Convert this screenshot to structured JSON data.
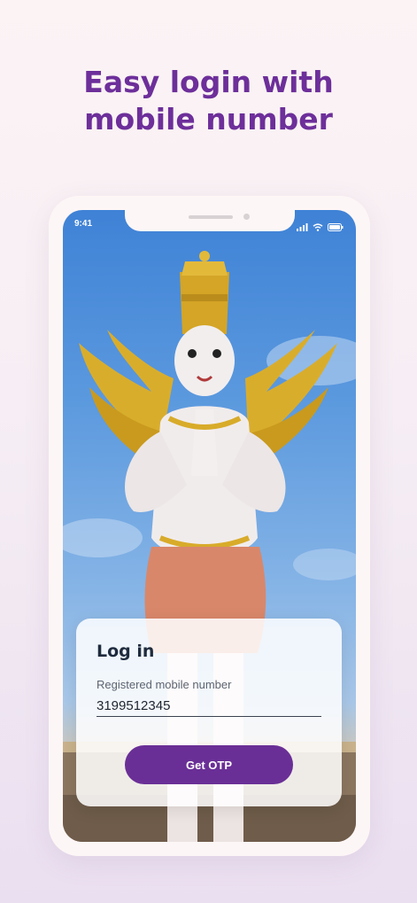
{
  "headline": {
    "line1": "Easy login with",
    "line2": "mobile number"
  },
  "status_bar": {
    "time": "9:41",
    "icons": [
      "signal-icon",
      "wifi-icon",
      "battery-icon"
    ]
  },
  "login_card": {
    "title": "Log in",
    "mobile_label": "Registered mobile number",
    "mobile_value": "3199512345",
    "button_label": "Get OTP"
  },
  "colors": {
    "accent": "#6a2f96",
    "headline": "#6d2f9a",
    "sky": "#4a8bd9"
  },
  "background_image": "garuda-statue"
}
